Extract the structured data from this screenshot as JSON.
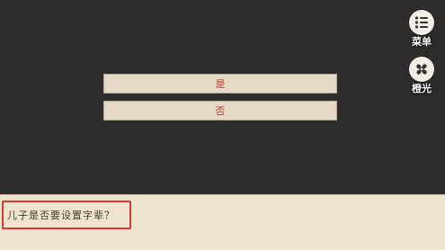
{
  "side_menu": {
    "menu_label": "菜单",
    "menu_icon": "list-icon",
    "fan_label": "橙光",
    "fan_icon": "pinwheel-icon"
  },
  "choices": [
    {
      "label": "是"
    },
    {
      "label": "否"
    }
  ],
  "dialog": {
    "text": "儿子是否要设置字辈？"
  },
  "colors": {
    "background": "#2e2c2b",
    "choice_bg": "#e4dac7",
    "choice_text": "#c0392b",
    "dialog_bg": "#ece3d1",
    "highlight_border": "#d23b2e"
  }
}
